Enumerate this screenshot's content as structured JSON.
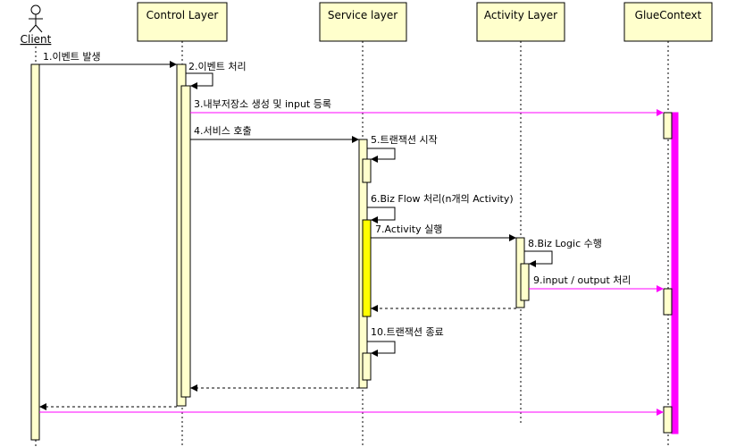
{
  "participants": {
    "client": "Client",
    "control": "Control Layer",
    "service": "Service layer",
    "activity": "Activity Layer",
    "glue": "GlueContext"
  },
  "messages": {
    "m1": "1.이벤트 발생",
    "m2": "2.이벤트 처리",
    "m3": "3.내부저장소 생성 및 input 등록",
    "m4": "4.서비스 호출",
    "m5": "5.트랜잭션 시작",
    "m6": "6.Biz Flow 처리(n개의 Activity)",
    "m7": "7.Activity 실행",
    "m8": "8.Biz Logic 수행",
    "m9": "9.input / output 처리",
    "m10": "10.트랜잭션 종료"
  },
  "colors": {
    "box_fill": "#ffffcc",
    "highlight_fill": "#ffff00",
    "glue_bar": "#ff00ff",
    "glue_arrow": "#ff00ff",
    "line": "#000000"
  },
  "icons": {
    "actor": "stick-figure-icon"
  }
}
